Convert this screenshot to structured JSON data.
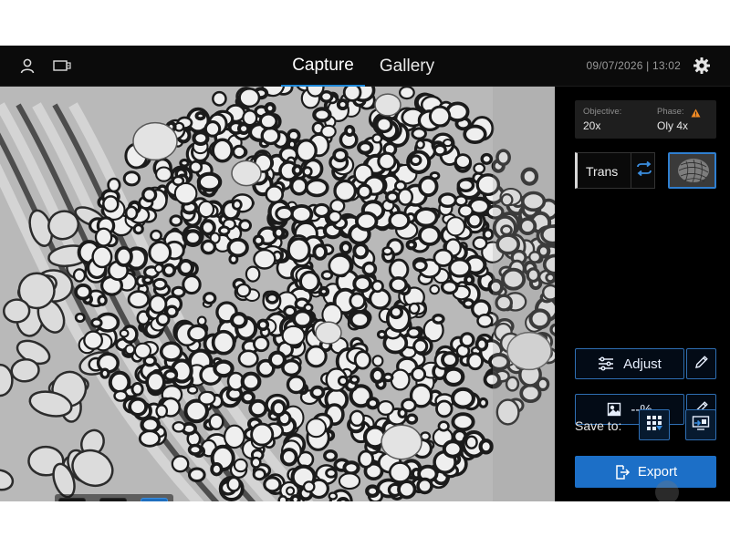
{
  "header": {
    "tabs": [
      {
        "label": "Capture",
        "active": true
      },
      {
        "label": "Gallery",
        "active": false
      }
    ],
    "datetime": "09/07/2026 | 13:02",
    "icons": [
      "user-icon",
      "camera-icon",
      "gear-icon"
    ]
  },
  "viewer": {
    "tools": [
      {
        "icon": "grid-icon",
        "active": false
      },
      {
        "icon": "measure-icon",
        "active": false
      },
      {
        "icon": "palette-icon",
        "active": true
      }
    ]
  },
  "panel": {
    "objective": {
      "label": "Objective:",
      "value": "20x"
    },
    "phase": {
      "label": "Phase:",
      "value": "Oly 4x",
      "warning_icon": "warning-icon"
    },
    "mode": {
      "label": "Trans",
      "swap_icon": "swap-icon"
    },
    "adjust": {
      "label": "Adjust",
      "icon": "sliders-icon"
    },
    "exposure": {
      "label": "--%",
      "icon": "image-exposure-icon"
    },
    "save_to_label": "Save to:",
    "save_targets": [
      "local-storage-icon",
      "network-share-icon"
    ],
    "export_label": "Export"
  },
  "colors": {
    "accent": "#1c6fc7",
    "outline": "#2f6fb4",
    "warning": "#f08a24",
    "background": "#000000"
  }
}
